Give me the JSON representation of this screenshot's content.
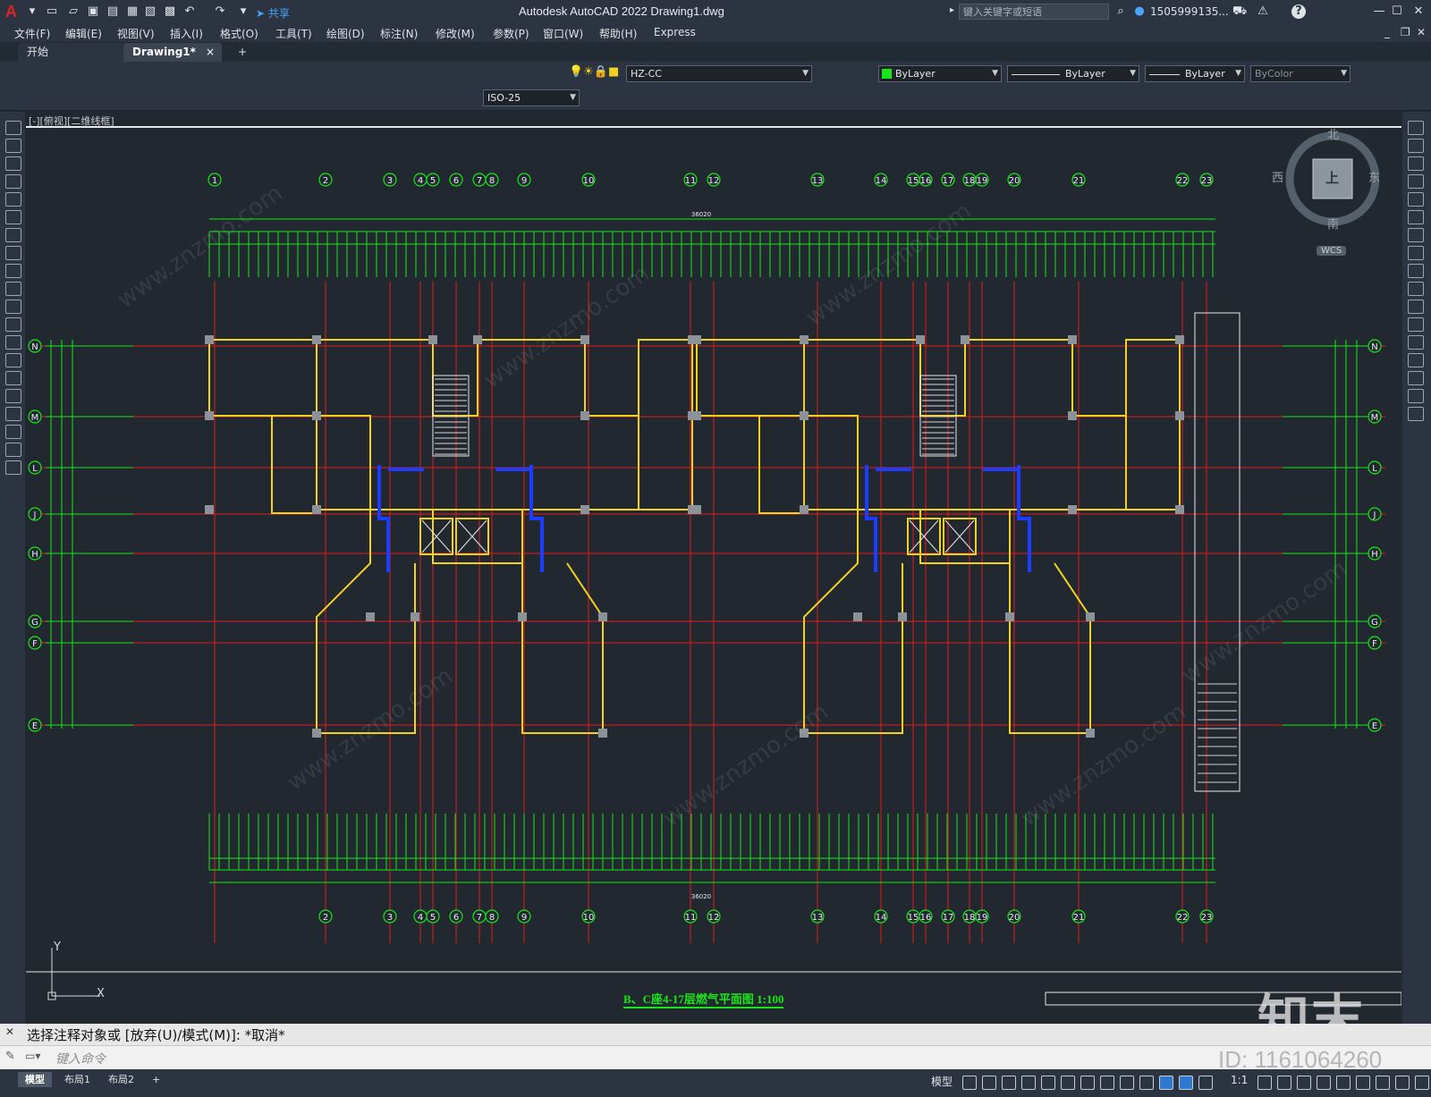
{
  "app": {
    "title": "Autodesk AutoCAD 2022    Drawing1.dwg",
    "share_label": "共享",
    "search_placeholder": "键入关键字或短语",
    "user": "1505999135...",
    "help": "?"
  },
  "menu": [
    "文件(F)",
    "编辑(E)",
    "视图(V)",
    "插入(I)",
    "格式(O)",
    "工具(T)",
    "绘图(D)",
    "标注(N)",
    "修改(M)",
    "参数(P)",
    "窗口(W)",
    "帮助(H)",
    "Express"
  ],
  "tabs": {
    "start": "开始",
    "active": "Drawing1*",
    "close": "×",
    "add": "+"
  },
  "toolbar": {
    "layer_name": "HZ-CC",
    "color": "ByLayer",
    "linetype": "ByLayer",
    "lineweight": "ByLayer",
    "plotstyle": "ByColor",
    "dimstyle": "ISO-25"
  },
  "viewport": {
    "label": "[-][俯视][二维线框]"
  },
  "viewcube": {
    "north": "北",
    "south": "南",
    "east": "东",
    "west": "西",
    "top": "上",
    "wcs": "WCS"
  },
  "drawing": {
    "title": "B、C座4-17层燃气平面图 1:100",
    "axis_top": [
      "1",
      "2",
      "3",
      "4",
      "5",
      "6",
      "7",
      "8",
      "9",
      "10",
      "11",
      "12",
      "13",
      "14",
      "15",
      "16",
      "17",
      "18",
      "19",
      "20",
      "21",
      "22",
      "23"
    ],
    "axis_bottom": [
      "2",
      "3",
      "4",
      "5",
      "6",
      "7",
      "8",
      "9",
      "10",
      "11",
      "12",
      "13",
      "14",
      "15",
      "16",
      "17",
      "18",
      "19",
      "20",
      "21",
      "22",
      "23"
    ],
    "axis_rows": [
      "N",
      "M",
      "L",
      "J",
      "H",
      "G",
      "F",
      "E"
    ],
    "overall_dim": "36020",
    "watermark": "www.znzmo.com",
    "logo": "知末",
    "ucs_y": "Y",
    "ucs_x": "X"
  },
  "command": {
    "history": "选择注释对象或 [放弃(U)/模式(M)]: *取消*",
    "placeholder": "键入命令"
  },
  "status": {
    "layouts": [
      "模型",
      "布局1",
      "布局2"
    ],
    "add": "+",
    "model": "模型",
    "scale": "1:1",
    "id": "ID: 1161064260"
  },
  "colors": {
    "accent": "#4aa3ff",
    "grid_green": "#19e619",
    "axis_red": "#e01b1b",
    "wall_yellow": "#f4d21f",
    "pipe_blue": "#1c3cff"
  }
}
